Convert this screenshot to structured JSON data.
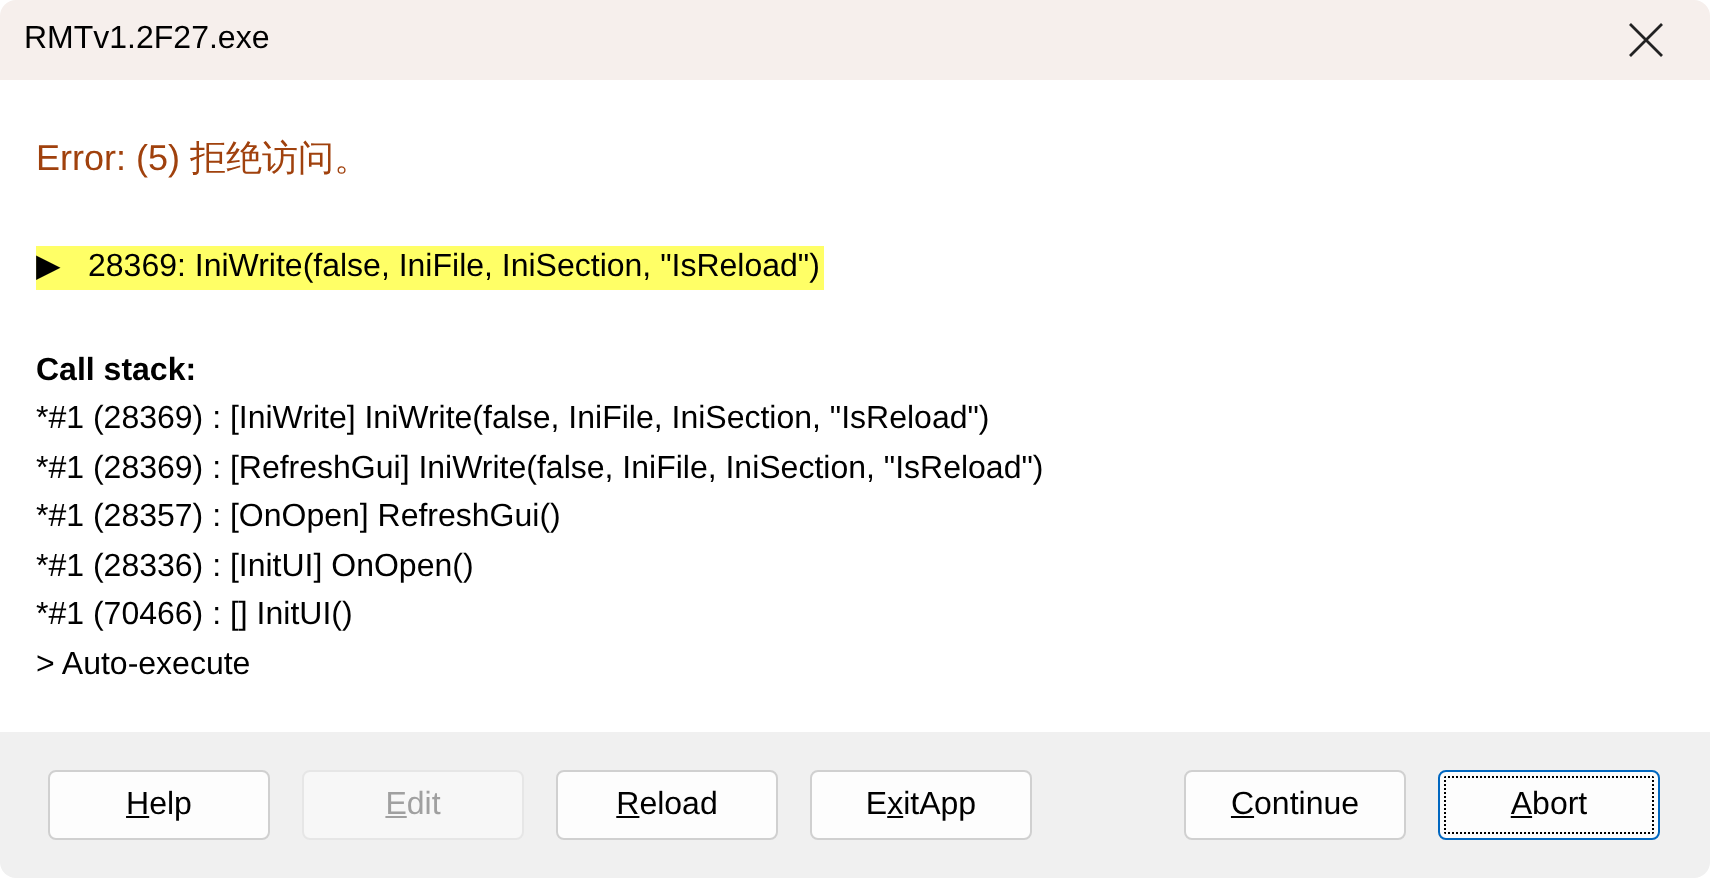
{
  "window": {
    "title": "RMTv1.2F27.exe"
  },
  "error": {
    "message": "Error: (5) 拒绝访问。",
    "marker": "▶",
    "line": "28369: IniWrite(false, IniFile, IniSection, \"IsReload\")"
  },
  "call_stack": {
    "heading": "Call stack:",
    "lines": [
      "*#1 (28369) : [IniWrite] IniWrite(false, IniFile, IniSection, \"IsReload\")",
      "*#1 (28369) : [RefreshGui] IniWrite(false, IniFile, IniSection, \"IsReload\")",
      "*#1 (28357) : [OnOpen] RefreshGui()",
      "*#1 (28336) : [InitUI] OnOpen()",
      "*#1 (70466) : [] InitUI()",
      "> Auto-execute"
    ]
  },
  "left_buttons": [
    {
      "key": "H",
      "post": "elp",
      "disabled": false,
      "focused": false
    },
    {
      "key": "E",
      "post": "dit",
      "disabled": true,
      "focused": false
    },
    {
      "key": "R",
      "post": "eload",
      "disabled": false,
      "focused": false
    },
    {
      "pre": "E",
      "key": "x",
      "post": "itApp",
      "disabled": false,
      "focused": false
    }
  ],
  "right_buttons": [
    {
      "key": "C",
      "post": "ontinue",
      "disabled": false,
      "focused": false
    },
    {
      "key": "A",
      "post": "bort",
      "disabled": false,
      "focused": true
    }
  ]
}
